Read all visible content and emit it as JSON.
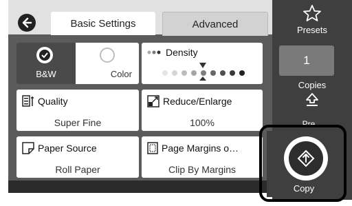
{
  "tabs": {
    "basic": "Basic Settings",
    "advanced": "Advanced"
  },
  "color_mode": {
    "bw": "B&W",
    "color": "Color"
  },
  "density": {
    "label": "Density",
    "level_of_9": 5
  },
  "quality": {
    "label": "Quality",
    "value": "Super Fine"
  },
  "reduce_enlarge": {
    "label": "Reduce/Enlarge",
    "value": "100%"
  },
  "paper_source": {
    "label": "Paper Source",
    "value": "Roll Paper"
  },
  "page_margins": {
    "label": "Page Margins o…",
    "value": "Clip By Margins"
  },
  "sidebar": {
    "presets": "Presets",
    "copies_value": "1",
    "copies_label": "Copies",
    "copy": "Copy",
    "cut_label": "Pre..."
  },
  "icons": [
    "back-icon",
    "check-icon",
    "spinner-icon",
    "dots-icon",
    "quality-icon",
    "reduce-enlarge-icon",
    "paper-source-icon",
    "page-margins-icon",
    "star-icon",
    "home-icon",
    "copy-diamond-icon"
  ],
  "colors": {
    "panel_bg": "#5b5b5b",
    "sidebar_bg": "#3f3f3f",
    "selected_bw": "#4a4a4a"
  }
}
